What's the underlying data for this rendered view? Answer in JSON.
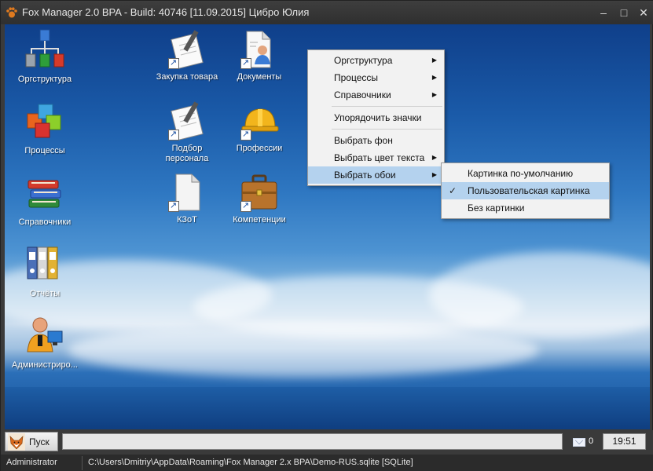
{
  "window": {
    "title": "Fox Manager 2.0 BPA - Build: 40746 [11.09.2015] Цибро Юлия",
    "minimize_glyph": "–",
    "maximize_glyph": "□",
    "close_glyph": "✕"
  },
  "desktop": {
    "icons": [
      {
        "label": "Оргструктура",
        "icon": "org-structure-icon"
      },
      {
        "label": "Процессы",
        "icon": "cubes-icon"
      },
      {
        "label": "Справочники",
        "icon": "books-icon"
      },
      {
        "label": "Отчёты",
        "icon": "binders-icon"
      },
      {
        "label": "Администриро...",
        "icon": "admin-user-icon"
      },
      {
        "label": "Закупка товара",
        "icon": "notepad-pen-icon"
      },
      {
        "label": "Документы",
        "icon": "document-person-icon"
      },
      {
        "label": "Подбор персонала",
        "icon": "notepad-pen-icon"
      },
      {
        "label": "Профессии",
        "icon": "hard-hat-icon"
      },
      {
        "label": "КЗоТ",
        "icon": "blank-document-icon"
      },
      {
        "label": "Компетенции",
        "icon": "briefcase-icon"
      }
    ]
  },
  "context_menu": {
    "items": [
      {
        "label": "Оргструктура",
        "has_submenu": true
      },
      {
        "label": "Процессы",
        "has_submenu": true
      },
      {
        "label": "Справочники",
        "has_submenu": true
      },
      {
        "label": "Упорядочить значки",
        "has_submenu": false
      },
      {
        "label": "Выбрать фон",
        "has_submenu": false
      },
      {
        "label": "Выбрать цвет текста",
        "has_submenu": true
      },
      {
        "label": "Выбрать обои",
        "has_submenu": true,
        "highlighted": true
      }
    ],
    "submenu_arrow": "▶"
  },
  "wallpaper_submenu": {
    "items": [
      {
        "label": "Картинка по-умолчанию",
        "checked": false
      },
      {
        "label": "Пользовательская картинка",
        "checked": true
      },
      {
        "label": "Без картинки",
        "checked": false
      }
    ],
    "check_glyph": "✓"
  },
  "taskbar": {
    "start_label": "Пуск",
    "mail_count": "0",
    "clock": "19:51"
  },
  "statusbar": {
    "user": "Administrator",
    "db_path": "C:\\Users\\Dmitriy\\AppData\\Roaming\\Fox Manager 2.x BPA\\Demo-RUS.sqlite [SQLite]"
  },
  "colors": {
    "menu_highlight": "#b4d2ee",
    "titlebar": "#3a3a3a",
    "desktop_sky": "#2f78c2"
  }
}
